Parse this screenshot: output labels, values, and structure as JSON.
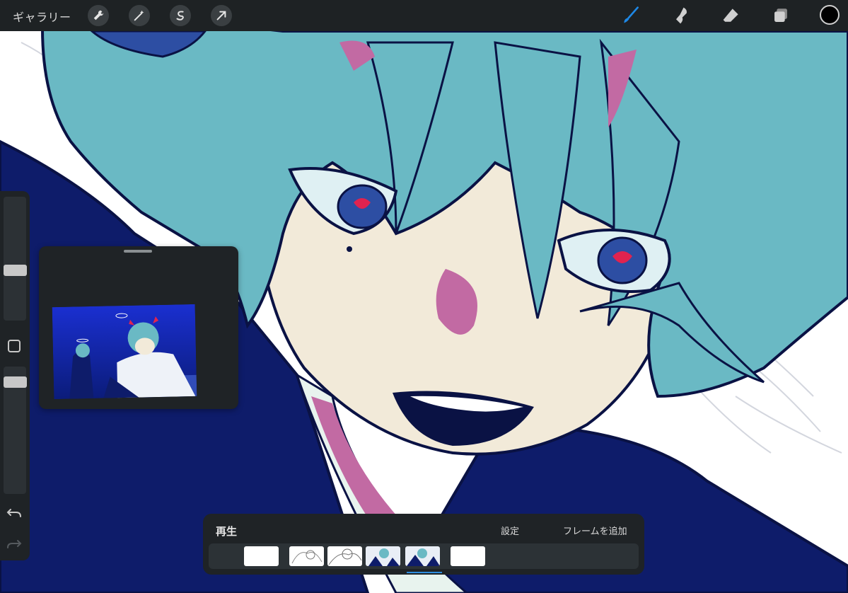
{
  "topbar": {
    "gallery_label": "ギャラリー",
    "left_tools": [
      "wrench-icon",
      "magic-wand-icon",
      "selection-icon",
      "transform-arrow-icon"
    ],
    "right_tools": [
      "brush-icon",
      "smudge-icon",
      "eraser-icon",
      "layers-icon"
    ],
    "active_tool": "brush-icon",
    "active_color": "#000000",
    "accent_color": "#1e88e5"
  },
  "sidebar": {
    "buttons": [
      "modify-button",
      "undo-icon",
      "redo-icon"
    ]
  },
  "animation": {
    "play_label": "再生",
    "settings_label": "設定",
    "add_frame_label": "フレームを追加",
    "frame_count": 6,
    "selected_frame_index": 4
  },
  "colors": {
    "hair": "#6ab9c4",
    "skin": "#f2ead9",
    "jacket": "#0e1c6a",
    "line": "#0a1244",
    "accent_pink": "#c26aa3",
    "eye_red": "#e0234f",
    "ui_bar": "#1e2224"
  }
}
